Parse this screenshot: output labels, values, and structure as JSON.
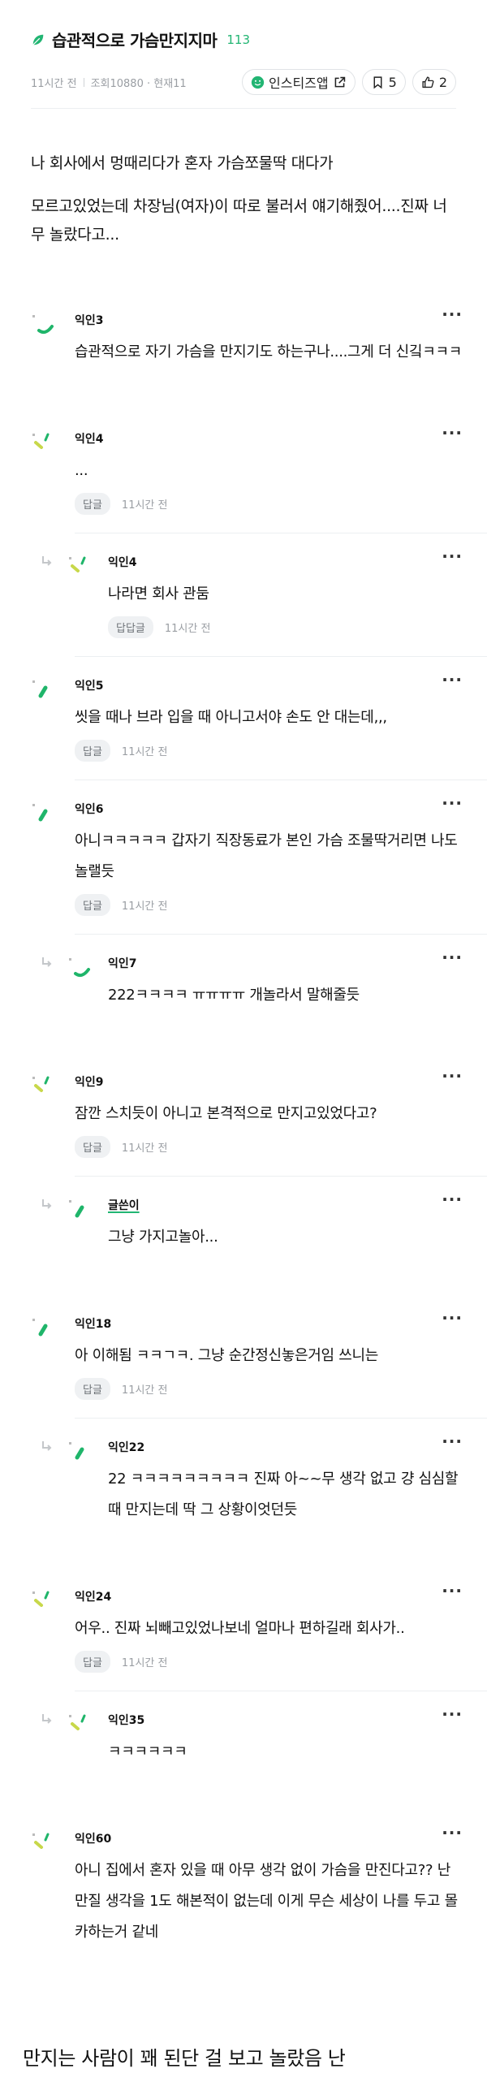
{
  "post": {
    "title": "습관적으로 가슴만지지마",
    "comment_count": "113",
    "time": "11시간 전",
    "views": "조회10880 · 현재11",
    "instiz_app": "인스티즈앱",
    "bookmark_count": "5",
    "like_count": "2",
    "body": [
      "나 회사에서 멍때리다가 혼자 가슴쪼물딱 대다가",
      "모르고있었는데 차장님(여자)이 따로 불러서 얘기해줬어....진짜 너무 놀랐다고..."
    ]
  },
  "comments": [
    {
      "nick": "익인3",
      "text": "습관적으로 자기 가슴을 만지기도 하는구나....그게 더 신깈ㅋㅋㅋ",
      "reply_label": "",
      "time": ""
    },
    {
      "nick": "익인4",
      "text": "...",
      "reply_label": "답글",
      "time": "11시간 전"
    },
    {
      "nick": "익인4",
      "text": "나라면 회사 관둠",
      "reply_label": "답답글",
      "time": "11시간 전"
    },
    {
      "nick": "익인5",
      "text": "씻을 때나 브라 입을 때 아니고서야 손도 안 대는데,,,",
      "reply_label": "답글",
      "time": "11시간 전"
    },
    {
      "nick": "익인6",
      "text": "아니ㅋㅋㅋㅋㅋ 갑자기 직장동료가 본인 가슴 조물딱거리면 나도 놀랠듯",
      "reply_label": "답글",
      "time": "11시간 전"
    },
    {
      "nick": "익인7",
      "text": "222ㅋㅋㅋㅋ ㅠㅠㅠㅠ 개놀라서 말해줄듯",
      "reply_label": "",
      "time": ""
    },
    {
      "nick": "익인9",
      "text": "잠깐 스치듯이 아니고 본격적으로 만지고있었다고?",
      "reply_label": "답글",
      "time": "11시간 전"
    },
    {
      "nick": "글쓴이",
      "text": "그냥 가지고놀아...",
      "reply_label": "",
      "time": ""
    },
    {
      "nick": "익인18",
      "text": "아 이해됨 ㅋㅋㄱㅋ. 그냥 순간정신놓은거임 쓰니는",
      "reply_label": "답글",
      "time": "11시간 전"
    },
    {
      "nick": "익인22",
      "text": "22 ㅋㅋㅋㅋㅋㅋㅋㅋㅋ 진짜 아~~무 생각 없고 걍 심심할때 만지는데 딱 그 상황이엇던듯",
      "reply_label": "",
      "time": ""
    },
    {
      "nick": "익인24",
      "text": "어우.. 진짜 뇌빼고있었나보네 얼마나 편하길래 회사가..",
      "reply_label": "답글",
      "time": "11시간 전"
    },
    {
      "nick": "익인35",
      "text": "ㅋㅋㅋㅋㅋㅋ",
      "reply_label": "",
      "time": ""
    },
    {
      "nick": "익인60",
      "text": "아니 집에서 혼자 있을 때 아무 생각 없이 가슴을 만진다고?? 난 만질 생각을 1도 해본적이 없는데 이게 무슨 세상이 나를 두고 몰카하는거 같네",
      "reply_label": "",
      "time": ""
    }
  ],
  "more_label": "···",
  "next_post_title": "만지는 사람이 꽤 된단 걸 보고 놀랐음 난",
  "colors": {
    "accent": "#22b573",
    "avatar_green": "#1fb56a",
    "avatar_yellow": "#c8d84a"
  }
}
